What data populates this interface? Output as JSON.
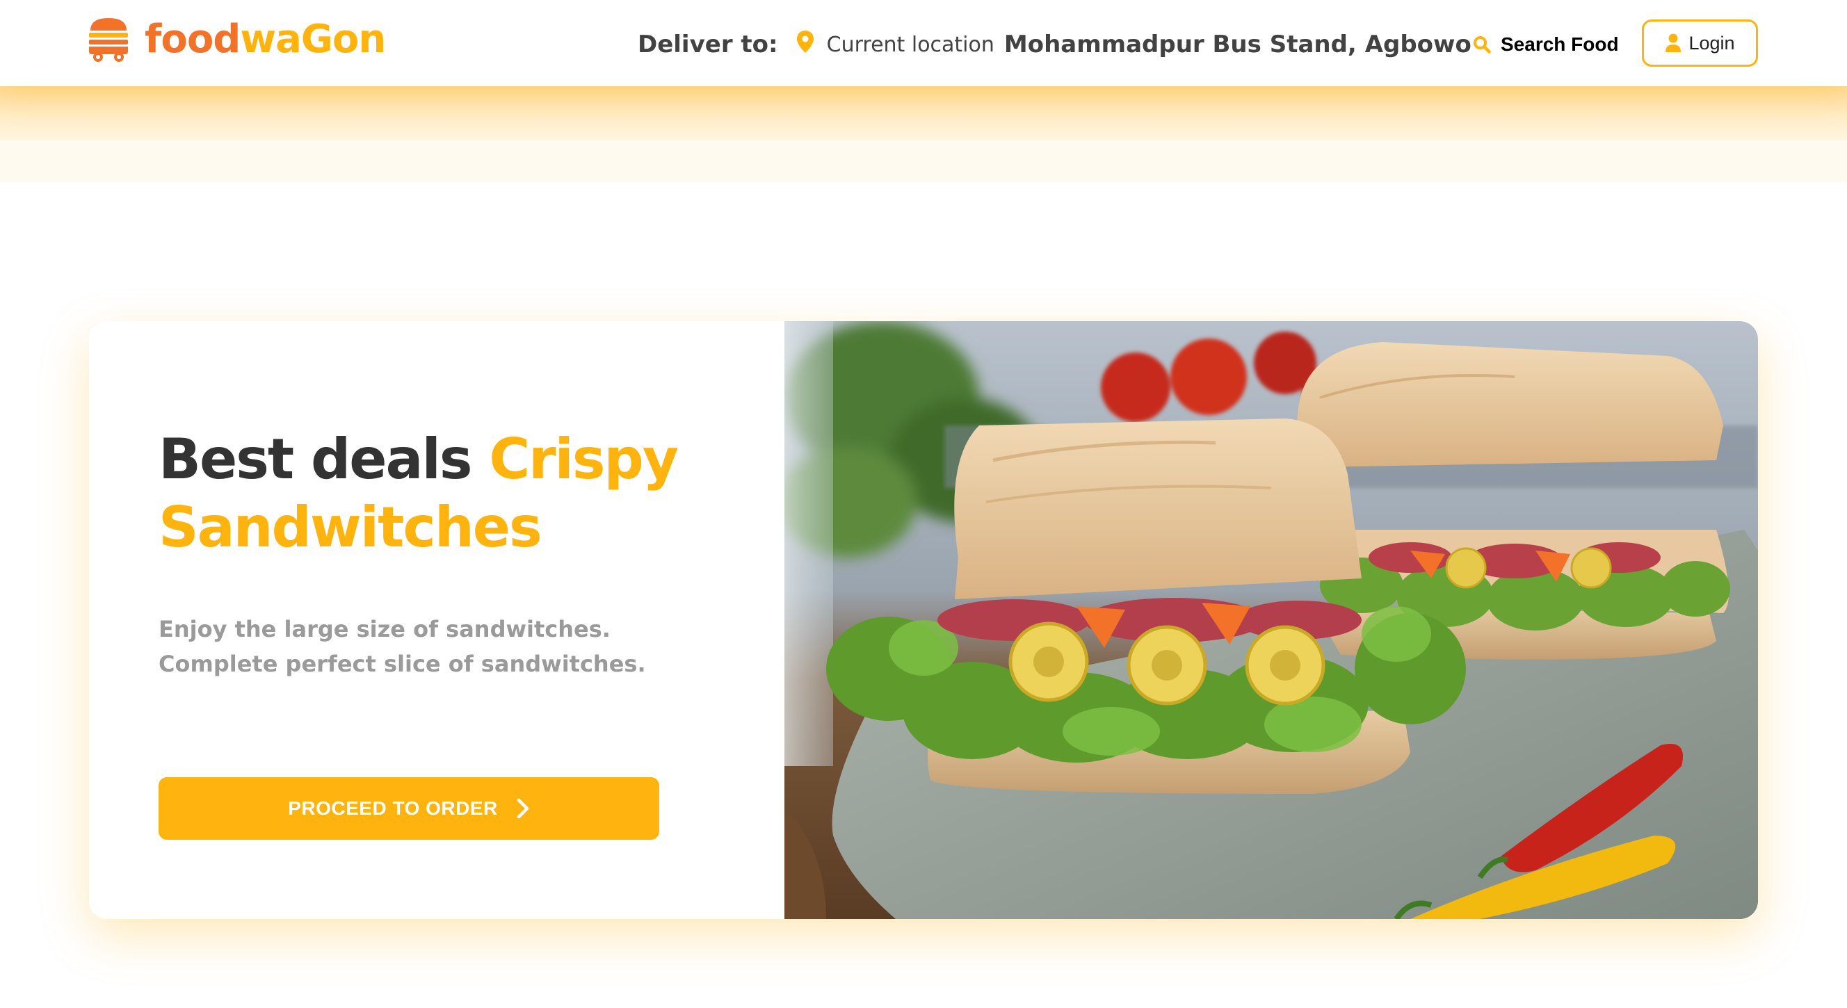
{
  "header": {
    "logo": {
      "part1": "food",
      "part2": "waGon"
    },
    "deliver_label": "Deliver to:",
    "current_location_label": "Current location",
    "address": "Mohammadpur Bus Stand, Agbowo",
    "search_label": "Search Food",
    "login_label": "Login"
  },
  "deal": {
    "title_plain": "Best deals ",
    "title_accent": "Crispy Sandwitches",
    "description": "Enjoy the large size of sandwitches. Complete perfect slice of sandwitches.",
    "button_label": "PROCEED TO ORDER",
    "image_alt": "sandwich-photo"
  },
  "colors": {
    "brand_orange": "#f17228",
    "brand_yellow": "#ffb30e",
    "text_dark": "#333333",
    "text_muted": "#9a9a9a"
  },
  "icons": {
    "logo": "burger-truck-icon",
    "location": "map-pin-icon",
    "search": "search-icon",
    "login": "user-icon",
    "order": "chevron-right-icon"
  }
}
